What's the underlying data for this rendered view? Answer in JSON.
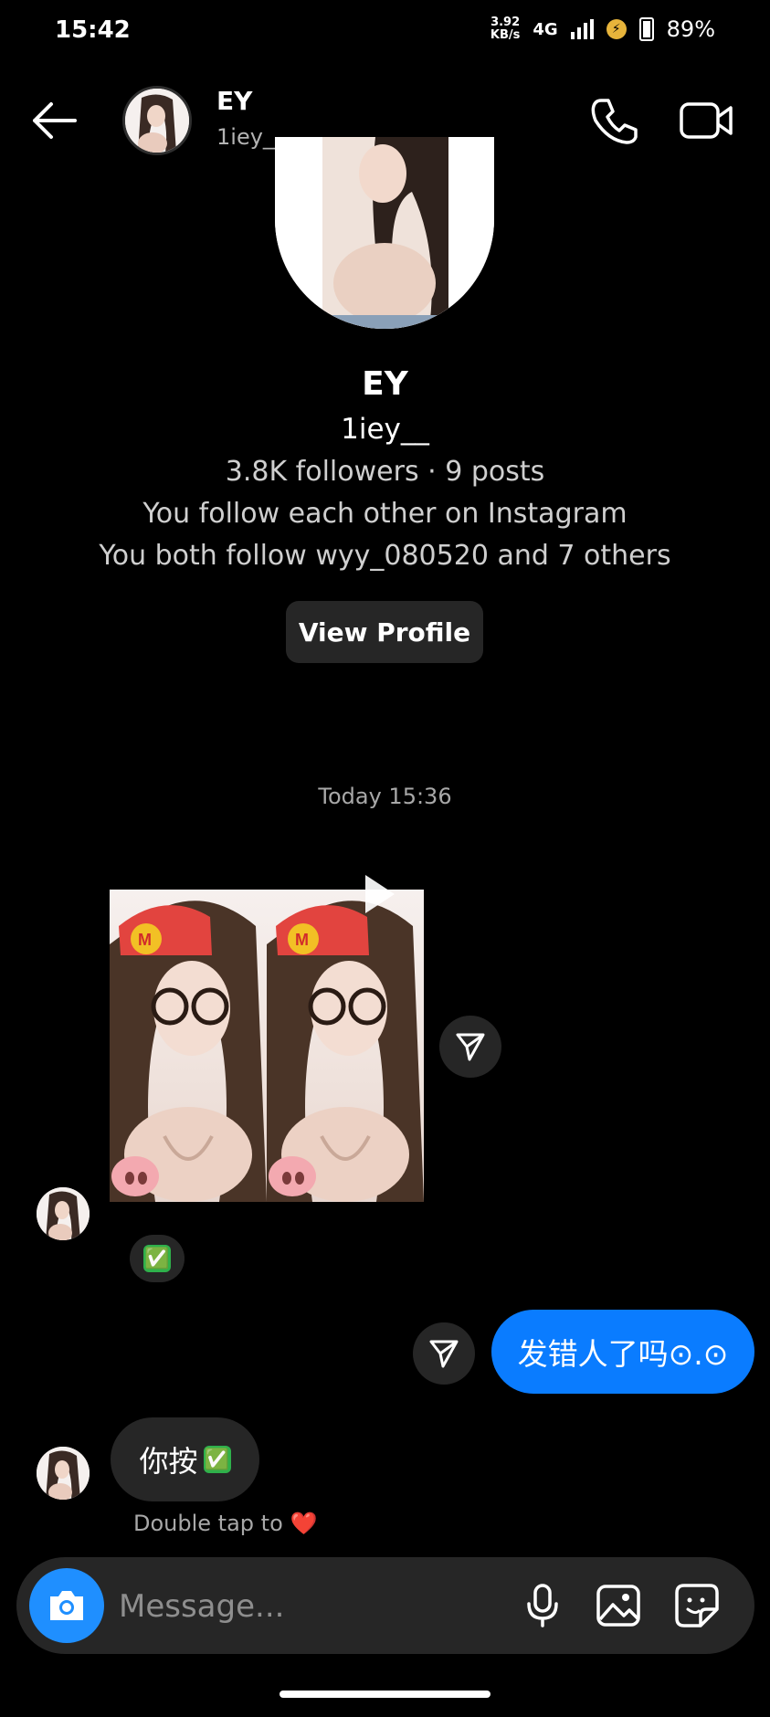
{
  "status_bar": {
    "time": "15:42",
    "speed_value": "3.92",
    "speed_unit": "KB/s",
    "network": "4G",
    "battery": "89%"
  },
  "header": {
    "name": "EY",
    "username": "1iey__",
    "icons": [
      "back-arrow-icon",
      "phone-icon",
      "video-camera-icon"
    ]
  },
  "profile": {
    "name": "EY",
    "username": "1iey__",
    "stats": "3.8K followers · 9 posts",
    "relation": "You follow each other on Instagram",
    "mutuals": "You both follow wyy_080520 and 7 others",
    "view_profile_label": "View Profile"
  },
  "thread": {
    "timestamp": "Today 15:36",
    "messages": [
      {
        "from": "them",
        "type": "reel"
      },
      {
        "from": "me",
        "text": "发错人了吗⊙.⊙"
      },
      {
        "from": "them",
        "text": "你按"
      }
    ],
    "reaction_emoji": "✅",
    "double_tap_hint": "Double tap to",
    "heart": "❤️"
  },
  "composer": {
    "placeholder": "Message...",
    "icons": [
      "camera-icon",
      "microphone-icon",
      "gallery-icon",
      "sticker-icon"
    ]
  },
  "colors": {
    "accent_blue": "#0a7cff",
    "bubble_gray": "#262626",
    "background": "#000000"
  }
}
